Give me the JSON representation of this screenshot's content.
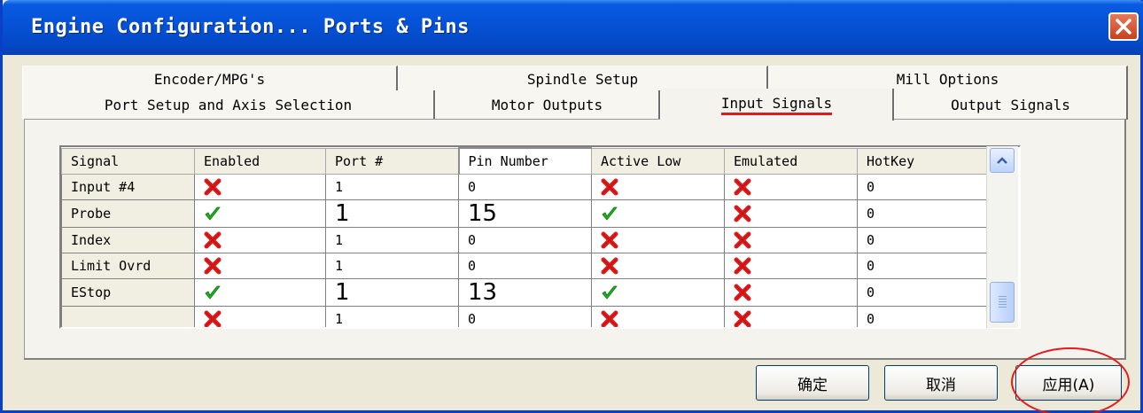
{
  "window": {
    "title": "Engine Configuration... Ports & Pins",
    "close_icon": "close-x-icon"
  },
  "tabs": {
    "row_back": [
      {
        "label": "Encoder/MPG's"
      },
      {
        "label": "Spindle Setup"
      },
      {
        "label": "Mill Options"
      }
    ],
    "row_front": [
      {
        "label": "Port Setup and Axis Selection"
      },
      {
        "label": "Motor Outputs"
      },
      {
        "label": "Input Signals"
      },
      {
        "label": "Output Signals"
      }
    ],
    "active": "Input Signals"
  },
  "grid": {
    "columns": [
      "Signal",
      "Enabled",
      "Port #",
      "Pin Number",
      "Active Low",
      "Emulated",
      "HotKey"
    ],
    "sorted_column": "Pin Number",
    "rows": [
      {
        "signal": "Input #4",
        "enabled": "no",
        "port": "1",
        "pin": "0",
        "active_low": "no",
        "emulated": "no",
        "hotkey": "0"
      },
      {
        "signal": "Probe",
        "enabled": "yes",
        "port": "1",
        "pin": "15",
        "active_low": "yes",
        "emulated": "no",
        "hotkey": "0"
      },
      {
        "signal": "Index",
        "enabled": "no",
        "port": "1",
        "pin": "0",
        "active_low": "no",
        "emulated": "no",
        "hotkey": "0"
      },
      {
        "signal": "Limit Ovrd",
        "enabled": "no",
        "port": "1",
        "pin": "0",
        "active_low": "no",
        "emulated": "no",
        "hotkey": "0"
      },
      {
        "signal": "EStop",
        "enabled": "yes",
        "port": "1",
        "pin": "13",
        "active_low": "yes",
        "emulated": "no",
        "hotkey": "0"
      },
      {
        "signal": "",
        "enabled": "no",
        "port": "1",
        "pin": "0",
        "active_low": "no",
        "emulated": "no",
        "hotkey": "0"
      }
    ],
    "check_icon": "green-check-icon",
    "cross_icon": "red-x-icon",
    "colors": {
      "check": "#1fb51f",
      "cross": "#e01a1a"
    }
  },
  "buttons": {
    "ok": "确定",
    "cancel": "取消",
    "apply": "应用(A)"
  },
  "colors": {
    "titlebar": "#0553d8",
    "highlight": "#e21b1b"
  }
}
